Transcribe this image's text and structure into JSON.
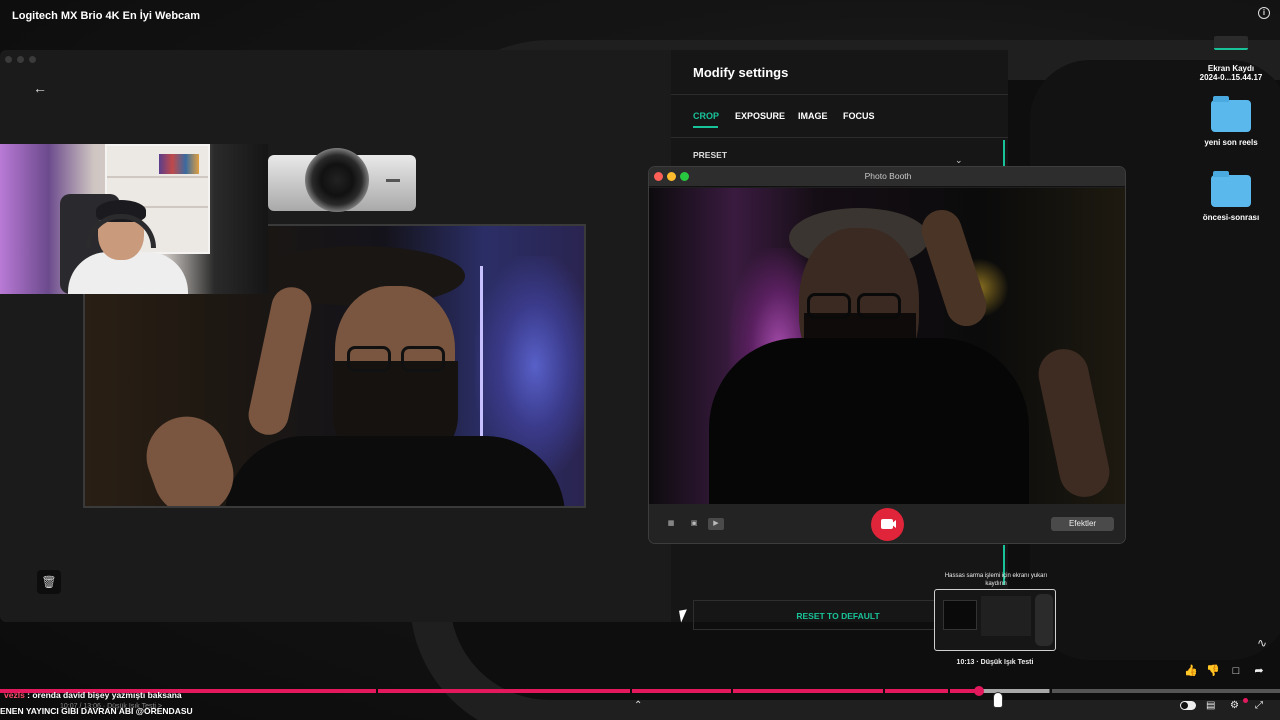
{
  "video": {
    "title": "Logitech MX Brio 4K En İyi Webcam",
    "info_icon": "info-icon"
  },
  "desktop": {
    "items": [
      {
        "label_line1": "Ekran Kaydı",
        "label_line2": "2024-0...15.44.17",
        "icon": "file-icon"
      },
      {
        "label": "yeni son reels",
        "icon": "folder-icon"
      },
      {
        "label": "öncesi-sonrası",
        "icon": "folder-icon"
      }
    ]
  },
  "logi_app": {
    "back_icon": "back-arrow-icon",
    "delete_icon": "trash-icon",
    "panel": {
      "title": "Modify settings",
      "tabs": [
        {
          "label": "CROP",
          "active": true
        },
        {
          "label": "EXPOSURE",
          "active": false
        },
        {
          "label": "IMAGE",
          "active": false
        },
        {
          "label": "FOCUS",
          "active": false
        }
      ],
      "preset_label": "PRESET",
      "reset_label": "RESET TO DEFAULT",
      "accent": "#19c39a"
    }
  },
  "photo_booth": {
    "title": "Photo Booth",
    "effects_label": "Efektler",
    "record_color": "#e0243a"
  },
  "thumbnail": {
    "hint": "Hassas sarma işlemi için ekranı yukarı kaydırın",
    "caption": "10:13 · Düşük Işık Testi"
  },
  "player": {
    "progress_fraction": 0.765,
    "buffer_fraction": 0.82,
    "progress_color": "#e3185d",
    "time_label": "10:07 / 13:06 · Düşük Işık Testi >"
  },
  "chat": {
    "user": "vezls",
    "message": " : orenda david bişey yazmıştı baksana",
    "ticker": "ENEN YAYINCI GIBI DAVRAN ABI @ORENDASU"
  }
}
